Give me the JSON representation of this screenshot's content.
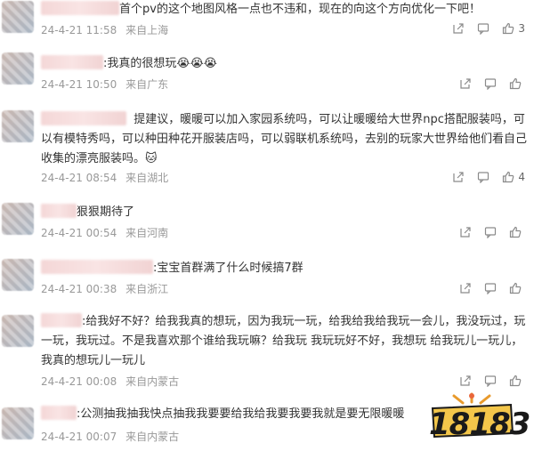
{
  "comments": [
    {
      "text": "首个pv的这个地图风格一点也不违和，现在的向这个方向优化一下吧！",
      "date": "24-4-21 11:58",
      "location": "来自上海",
      "likes": "3"
    },
    {
      "text": ":我真的很想玩",
      "emoji": "😭😭😭",
      "date": "24-4-21 10:50",
      "location": "来自广东",
      "likes": ""
    },
    {
      "text": "提建议，暖暖可以加入家园系统吗，可以让暖暖给大世界npc搭配服装吗，可以有模特秀吗，可以种田种花开服装店吗，可以弱联机系统吗，去别的玩家大世界给他们看自己收集的漂亮服装吗。",
      "emoji": "🐱",
      "date": "24-4-21 08:54",
      "location": "来自湖北",
      "likes": "4"
    },
    {
      "text": "狠狠期待了",
      "date": "24-4-21 00:54",
      "location": "来自河南",
      "likes": ""
    },
    {
      "text": ":宝宝首群满了什么时候搞7群",
      "date": "24-4-21 00:38",
      "location": "来自浙江",
      "likes": ""
    },
    {
      "text": ":给我好不好？给我我真的想玩，因为我玩一玩，给我给我给我玩一会儿，我没玩过，玩一玩，我玩过。不是我喜欢那个谁给我玩嘛？给我玩 我玩玩好不好，我想玩 给我玩儿一玩儿，我真的想玩儿一玩儿",
      "date": "24-4-21 00:08",
      "location": "来自内蒙古",
      "likes": ""
    },
    {
      "text": ":公测抽我抽我快点抽我我要要给我给我要我要我就是要无限暖暖",
      "date": "24-4-21 00:07",
      "location": "来自内蒙古",
      "likes": ""
    }
  ],
  "watermark": {
    "text": "18183"
  },
  "icons": {
    "share": "share-icon",
    "comment": "comment-icon",
    "like": "thumbs-up-icon"
  },
  "colors": {
    "text": "#333333",
    "meta": "#999999",
    "icon": "#8a8a8a"
  }
}
